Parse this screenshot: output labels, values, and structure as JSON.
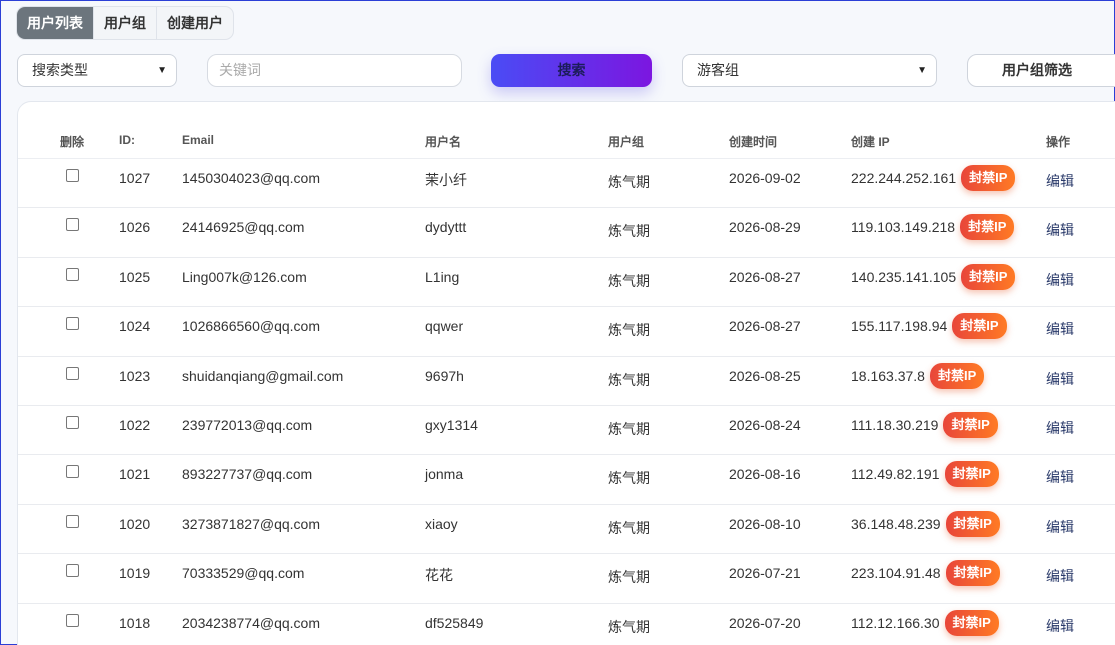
{
  "tabs": [
    "用户列表",
    "用户组",
    "创建用户"
  ],
  "toolbar": {
    "search_type": "搜索类型",
    "keyword_placeholder": "关键词",
    "search_button": "搜索",
    "group_select": "游客组",
    "group_filter_button": "用户组筛选"
  },
  "table": {
    "headers": {
      "delete": "删除",
      "id": "ID:",
      "email": "Email",
      "username": "用户名",
      "group": "用户组",
      "created": "创建时间",
      "ip": "创建 IP",
      "action": "操作"
    },
    "ban_label": "封禁IP",
    "edit_label": "编辑",
    "rows": [
      {
        "id": "1027",
        "email": "1450304023@qq.com",
        "username": "茉小纤",
        "group": "炼气期",
        "created": "2026-09-02",
        "ip": "222.244.252.161"
      },
      {
        "id": "1026",
        "email": "24146925@qq.com",
        "username": "dydyttt",
        "group": "炼气期",
        "created": "2026-08-29",
        "ip": "119.103.149.218"
      },
      {
        "id": "1025",
        "email": "Ling007k@126.com",
        "username": "L1ing",
        "group": "炼气期",
        "created": "2026-08-27",
        "ip": "140.235.141.105"
      },
      {
        "id": "1024",
        "email": "1026866560@qq.com",
        "username": "qqwer",
        "group": "炼气期",
        "created": "2026-08-27",
        "ip": "155.117.198.94"
      },
      {
        "id": "1023",
        "email": "shuidanqiang@gmail.com",
        "username": "9697h",
        "group": "炼气期",
        "created": "2026-08-25",
        "ip": "18.163.37.8"
      },
      {
        "id": "1022",
        "email": "239772013@qq.com",
        "username": "gxy1314",
        "group": "炼气期",
        "created": "2026-08-24",
        "ip": "111.18.30.219"
      },
      {
        "id": "1021",
        "email": "893227737@qq.com",
        "username": "jonma",
        "group": "炼气期",
        "created": "2026-08-16",
        "ip": "112.49.82.191"
      },
      {
        "id": "1020",
        "email": "3273871827@qq.com",
        "username": "xiaoy",
        "group": "炼气期",
        "created": "2026-08-10",
        "ip": "36.148.48.239"
      },
      {
        "id": "1019",
        "email": "70333529@qq.com",
        "username": "花花",
        "group": "炼气期",
        "created": "2026-07-21",
        "ip": "223.104.91.48"
      },
      {
        "id": "1018",
        "email": "2034238774@qq.com",
        "username": "df525849",
        "group": "炼气期",
        "created": "2026-07-20",
        "ip": "112.12.166.30"
      }
    ]
  }
}
